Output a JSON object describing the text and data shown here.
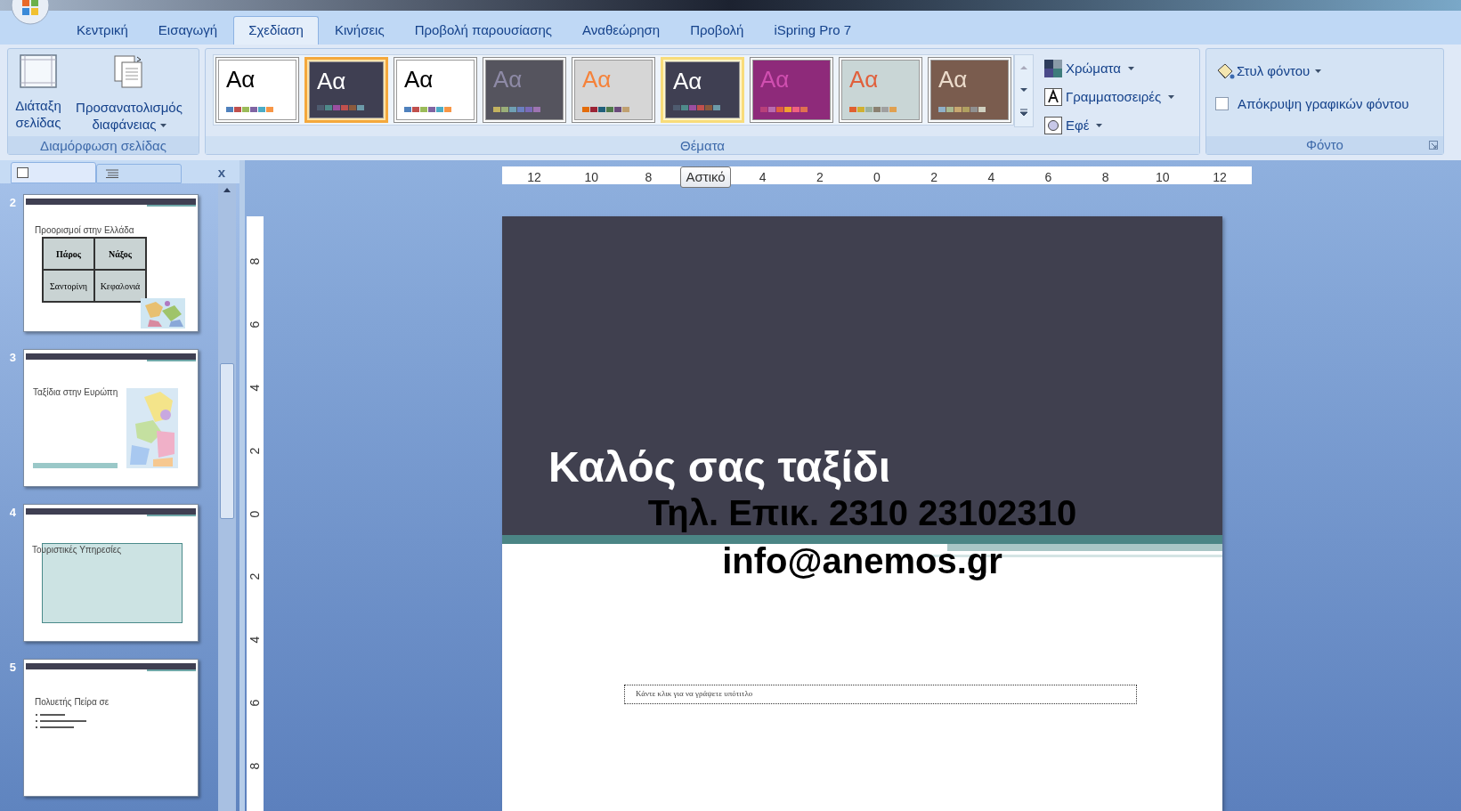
{
  "tabs": [
    {
      "label": "Κεντρική",
      "selected": false
    },
    {
      "label": "Εισαγωγή",
      "selected": false
    },
    {
      "label": "Σχεδίαση",
      "selected": true
    },
    {
      "label": "Κινήσεις",
      "selected": false
    },
    {
      "label": "Προβολή παρουσίασης",
      "selected": false
    },
    {
      "label": "Αναθεώρηση",
      "selected": false
    },
    {
      "label": "Προβολή",
      "selected": false
    },
    {
      "label": "iSpring Pro 7",
      "selected": false
    }
  ],
  "page_setup": {
    "label": "Διαμόρφωση σελίδας",
    "buttons": [
      {
        "label": "Διάταξη σελίδας",
        "kind": "layout"
      },
      {
        "label": "Προσανατολισμός διαφάνειας",
        "kind": "orientation"
      }
    ]
  },
  "themes": {
    "label": "Θέματα",
    "items": [
      {
        "kind": "plain",
        "sample": "Aα",
        "selected": false,
        "highlighted": false
      },
      {
        "kind": "dark",
        "sample": "Aα",
        "selected": true,
        "highlighted": false
      },
      {
        "kind": "plain",
        "sample": "Aα",
        "selected": false,
        "highlighted": false
      },
      {
        "kind": "gray",
        "sample": "Aα",
        "selected": false,
        "highlighted": false
      },
      {
        "kind": "silver",
        "sample": "Aα",
        "selected": false,
        "highlighted": false
      },
      {
        "kind": "dark",
        "sample": "Aα",
        "selected": false,
        "highlighted": true
      },
      {
        "kind": "magenta",
        "sample": "Aα",
        "selected": false,
        "highlighted": false
      },
      {
        "kind": "aqua",
        "sample": "Aα",
        "selected": false,
        "highlighted": false
      },
      {
        "kind": "brown",
        "sample": "Aα",
        "selected": false,
        "highlighted": false
      }
    ],
    "commands": [
      {
        "label": "Χρώματα",
        "kind": "colors"
      },
      {
        "label": "Γραμματοσειρές",
        "kind": "fonts"
      },
      {
        "label": "Εφέ",
        "kind": "effects"
      }
    ]
  },
  "background": {
    "label": "Φόντο",
    "style_button": "Στυλ φόντου",
    "hide_graphics": {
      "label": "Απόκρυψη γραφικών φόντου",
      "checked": false
    }
  },
  "ruler": {
    "labels": [
      "12",
      "10",
      "8",
      "4",
      "2",
      "0",
      "2",
      "4",
      "6",
      "8",
      "10",
      "12"
    ],
    "tooltip": "Αστικό"
  },
  "vertical_ruler": {
    "labels": [
      "8",
      "6",
      "4",
      "2",
      "0",
      "2",
      "4",
      "6",
      "8"
    ]
  },
  "panel": {
    "close": "x"
  },
  "slides": [
    {
      "number": "2",
      "kind": "table",
      "title": "Προορισμοί στην Ελλάδα",
      "cells": [
        "Πάρος",
        "Νάξος",
        "Σαντορίνη",
        "Κεφαλονιά"
      ]
    },
    {
      "number": "3",
      "kind": "map",
      "title": "Ταξίδια στην Ευρώπη"
    },
    {
      "number": "4",
      "kind": "box",
      "title": "Τουριστικές Υπηρεσίες"
    },
    {
      "number": "5",
      "kind": "bullets",
      "title": "Πολυετής  Πείρα σε"
    }
  ],
  "current_slide": {
    "title": "Καλός σας ταξίδι",
    "lines": [
      "Τηλ. Επικ. 2310 23102310",
      "info@anemos.gr"
    ],
    "subtitle_placeholder": "Κάντε κλικ για να γράψετε υπότιτλο"
  }
}
